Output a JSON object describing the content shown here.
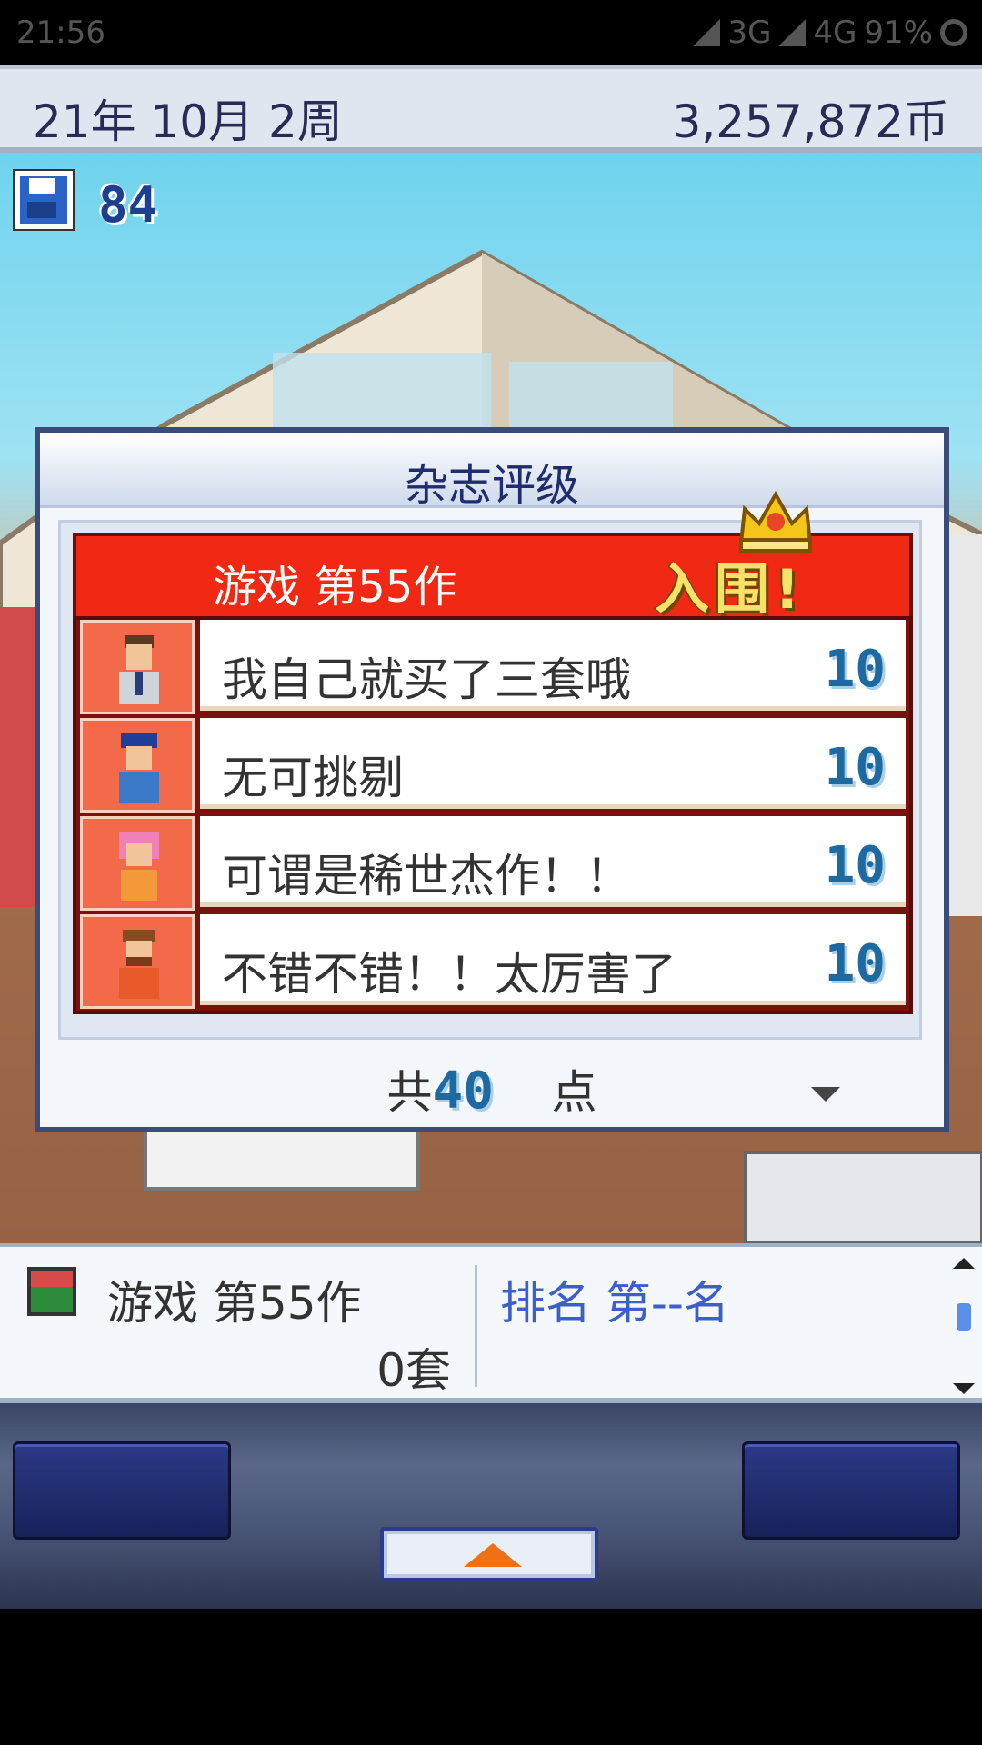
{
  "status_bar": {
    "time": "21:56",
    "network_3g": "3G",
    "network_4g": "4G",
    "battery": "91%"
  },
  "top_bar": {
    "date": "21年 10月 2周",
    "money": "3,257,872币"
  },
  "save": {
    "count": "84"
  },
  "dialog": {
    "title": "杂志评级",
    "game_title": "游戏 第55作",
    "nominated": "入围!",
    "reviews": [
      {
        "comment": "我自己就买了三套哦",
        "score": "10"
      },
      {
        "comment": "无可挑剔",
        "score": "10"
      },
      {
        "comment": "可谓是稀世杰作！！",
        "score": "10"
      },
      {
        "comment": "不错不错！！太厉害了",
        "score": "10"
      }
    ],
    "total_prefix": "共",
    "total_value": "40",
    "total_suffix": "点"
  },
  "info_panel": {
    "title": "游戏 第55作",
    "sales": "0套",
    "rank": "排名 第--名"
  },
  "colors": {
    "banner_red": "#f02814",
    "score_blue": "#1e6aa0",
    "rank_blue": "#3d5fc8"
  }
}
